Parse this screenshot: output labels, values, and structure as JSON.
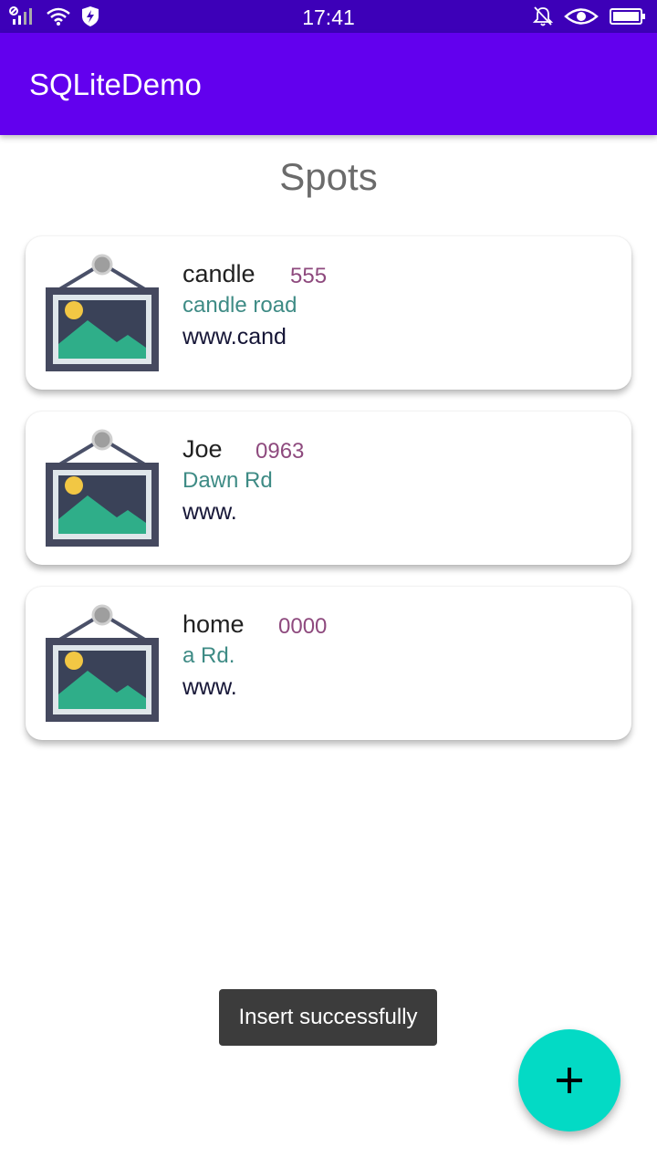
{
  "status_bar": {
    "time": "17:41"
  },
  "app_bar": {
    "title": "SQLiteDemo"
  },
  "page_title": "Spots",
  "spots": [
    {
      "name": "candle",
      "phone": "555",
      "address": "candle road",
      "website": "www.cand",
      "icon": "image-placeholder-icon"
    },
    {
      "name": "Joe",
      "phone": "0963",
      "address": "Dawn Rd",
      "website": "www.",
      "icon": "image-placeholder-icon"
    },
    {
      "name": "home",
      "phone": "0000",
      "address": "a Rd.",
      "website": "www.",
      "icon": "image-placeholder-icon"
    }
  ],
  "toast": {
    "message": "Insert successfully"
  },
  "fab": {
    "icon": "add-icon"
  },
  "colors": {
    "status_bar": "#3d00b8",
    "app_bar": "#6200ee",
    "fab": "#03dac5",
    "phone": "#8e4a7e",
    "address": "#3e8b85"
  }
}
